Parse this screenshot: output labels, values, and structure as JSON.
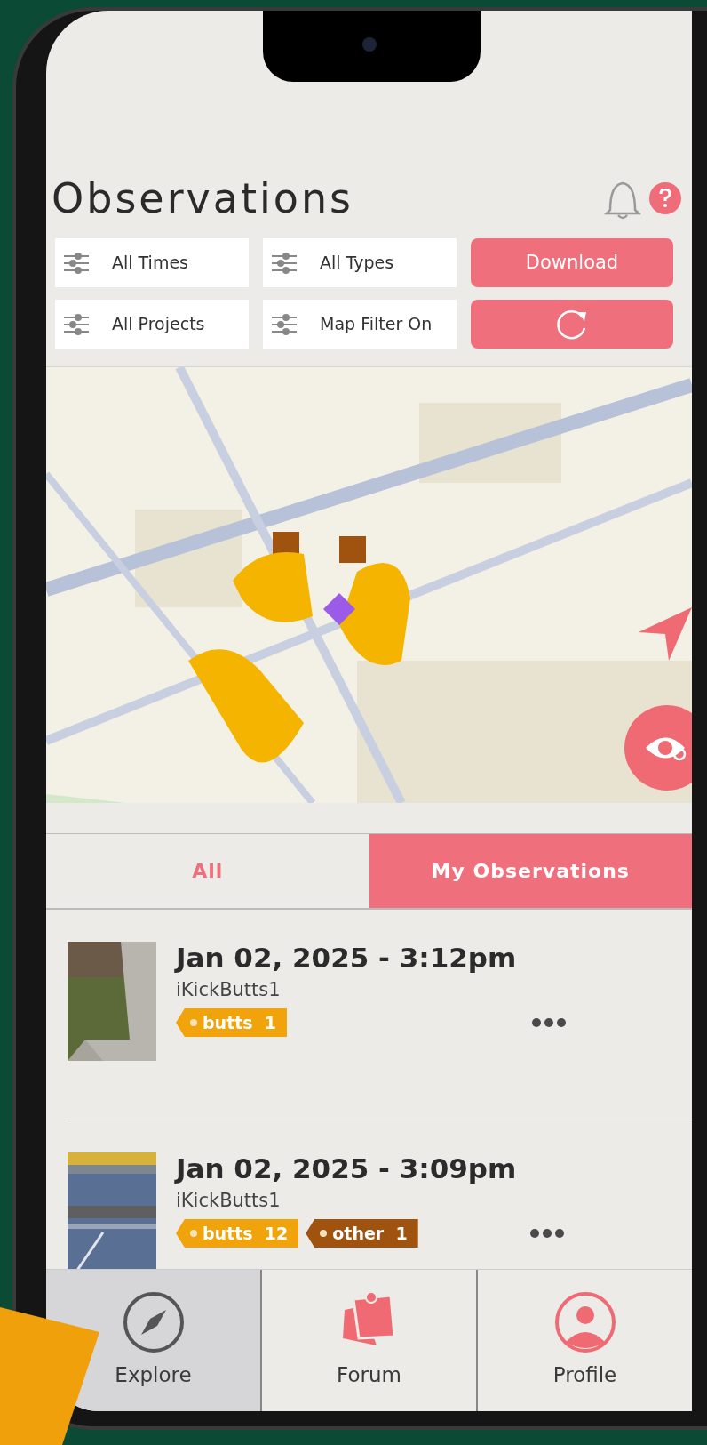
{
  "header": {
    "title": "Observations"
  },
  "filters": [
    {
      "label": "All Times"
    },
    {
      "label": "All Types"
    },
    {
      "label": "All Projects"
    },
    {
      "label": "Map Filter On"
    }
  ],
  "download_button": {
    "label": "Download"
  },
  "segments": [
    {
      "label": "All",
      "selected": false
    },
    {
      "label": "My Observations",
      "selected": true
    }
  ],
  "observations": [
    {
      "date": "Jan 02, 2025 - 3:12pm",
      "user": "iKickButts1",
      "tags": [
        {
          "label": "butts",
          "count": "1",
          "color": "#f0a30a"
        }
      ]
    },
    {
      "date": "Jan 02, 2025 - 3:09pm",
      "user": "iKickButts1",
      "tags": [
        {
          "label": "butts",
          "count": "12",
          "color": "#f0a30a"
        },
        {
          "label": "other",
          "count": "1",
          "color": "#a0520f"
        }
      ]
    }
  ],
  "tab_bar": [
    {
      "label": "Explore",
      "kind": "compass",
      "selected": true
    },
    {
      "label": "Forum",
      "kind": "notes",
      "selected": false
    },
    {
      "label": "Profile",
      "kind": "person",
      "selected": false
    }
  ]
}
